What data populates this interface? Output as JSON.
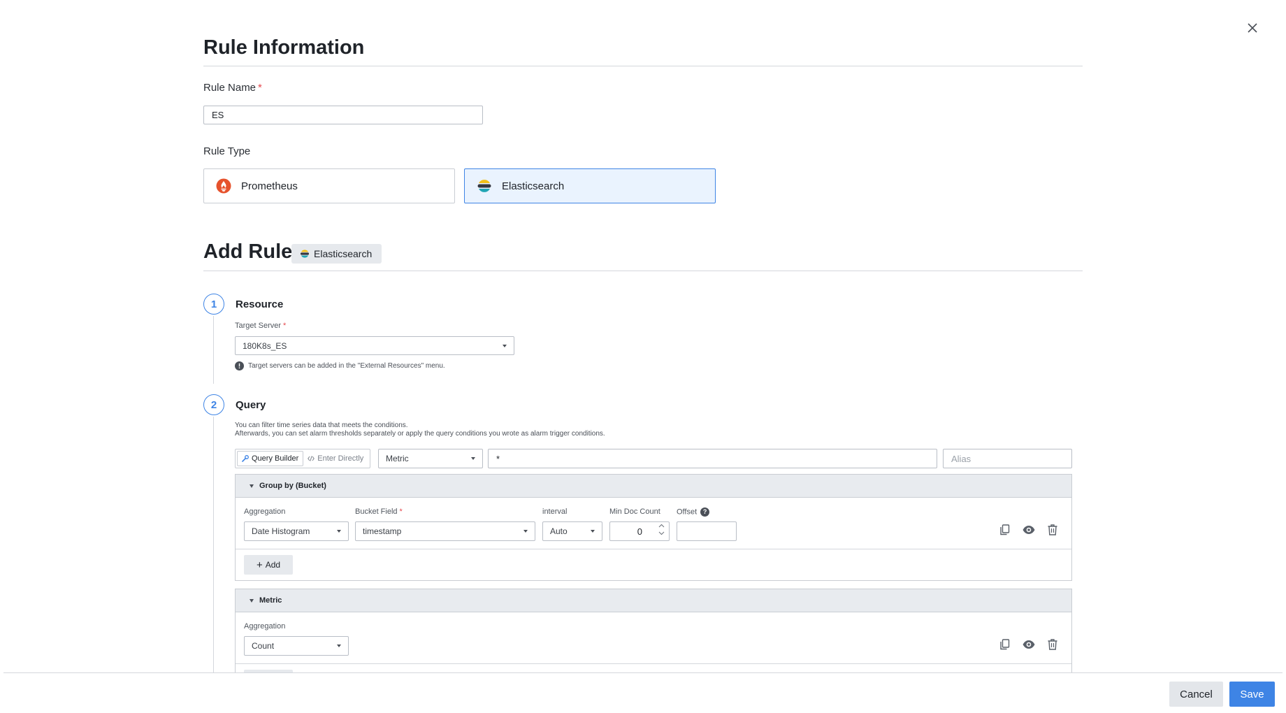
{
  "rule_info": {
    "title": "Rule Information",
    "rule_name_label": "Rule Name",
    "required_mark": "*",
    "rule_name_value": "ES",
    "rule_type_label": "Rule Type",
    "types": [
      {
        "label": "Prometheus",
        "icon": "prometheus-icon",
        "selected": false
      },
      {
        "label": "Elasticsearch",
        "icon": "elasticsearch-icon",
        "selected": true
      }
    ]
  },
  "add_rule": {
    "title": "Add Rule",
    "badge": "Elasticsearch"
  },
  "step1": {
    "number": "1",
    "title": "Resource",
    "target_label": "Target Server",
    "target_value": "180K8s_ES",
    "hint": "Target servers can be added in the \"External Resources\" menu."
  },
  "step2": {
    "number": "2",
    "title": "Query",
    "desc_line1": "You can filter time series data that meets the conditions.",
    "desc_line2": "Afterwards, you can set alarm thresholds separately or apply the query conditions you wrote as alarm trigger conditions.",
    "mode_builder": "Query Builder",
    "mode_direct": "Enter Directly",
    "query_type": "Metric",
    "query_value": "*",
    "alias_placeholder": "Alias",
    "group_by": {
      "title": "Group by (Bucket)",
      "aggregation_label": "Aggregation",
      "aggregation_value": "Date Histogram",
      "bucket_field_label": "Bucket Field",
      "bucket_field_value": "timestamp",
      "interval_label": "interval",
      "interval_value": "Auto",
      "min_doc_label": "Min Doc Count",
      "min_doc_value": "0",
      "offset_label": "Offset",
      "offset_help": "?",
      "offset_value": "",
      "add_label": "Add"
    },
    "metric": {
      "title": "Metric",
      "aggregation_label": "Aggregation",
      "aggregation_value": "Count"
    }
  },
  "footer": {
    "cancel": "Cancel",
    "save": "Save"
  },
  "colors": {
    "accent": "#3e84e5",
    "selected_bg": "#eaf3fe",
    "required": "#e5484d"
  }
}
